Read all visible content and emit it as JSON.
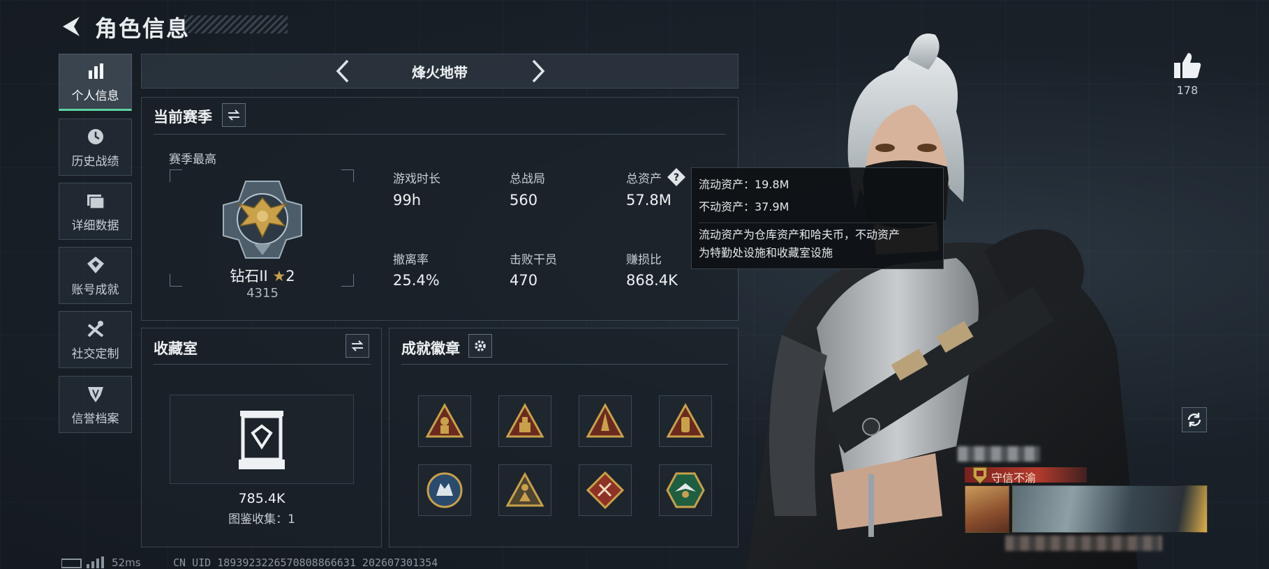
{
  "header": {
    "title": "角色信息"
  },
  "sidebar": {
    "items": [
      {
        "label": "个人信息",
        "icon": "bar-chart-icon",
        "active": true
      },
      {
        "label": "历史战绩",
        "icon": "clock-icon",
        "active": false
      },
      {
        "label": "详细数据",
        "icon": "folder-icon",
        "active": false
      },
      {
        "label": "账号成就",
        "icon": "achievement-icon",
        "active": false
      },
      {
        "label": "社交定制",
        "icon": "tools-icon",
        "active": false
      },
      {
        "label": "信誉档案",
        "icon": "shield-icon",
        "active": false
      }
    ]
  },
  "mode": {
    "name": "烽火地带"
  },
  "season": {
    "title": "当前赛季",
    "best_label": "赛季最高",
    "rank_name": "钻石II",
    "rank_stars": "2",
    "rank_points": "4315",
    "stats": [
      {
        "label": "游戏时长",
        "value": "99h"
      },
      {
        "label": "总战局",
        "value": "560"
      },
      {
        "label": "总资产",
        "value": "57.8M"
      },
      {
        "label": "撤离率",
        "value": "25.4%"
      },
      {
        "label": "击败干员",
        "value": "470"
      },
      {
        "label": "赚损比",
        "value": "868.4K"
      }
    ]
  },
  "tooltip": {
    "liquid": "流动资产：19.8M",
    "fixed": "不动资产：37.9M",
    "desc_line1": "流动资产为仓库资产和哈夫币，不动资产",
    "desc_line2": "为特勤处设施和收藏室设施"
  },
  "collection": {
    "title": "收藏室",
    "value": "785.4K",
    "count": "图鉴收集：1"
  },
  "badges": {
    "title": "成就徽章",
    "items": [
      {
        "icon": "soldier-triangle-badge-icon",
        "color": "#c9a14a"
      },
      {
        "icon": "crate-triangle-badge-icon",
        "color": "#c9a14a"
      },
      {
        "icon": "rocket-triangle-badge-icon",
        "color": "#c9a14a"
      },
      {
        "icon": "canister-triangle-badge-icon",
        "color": "#c9a14a"
      },
      {
        "icon": "wolf-circle-badge-icon",
        "color": "#3a6b9a"
      },
      {
        "icon": "figure-triangle-badge-icon",
        "color": "#c9a14a"
      },
      {
        "icon": "tools-diamond-badge-icon",
        "color": "#b5402f"
      },
      {
        "icon": "eagle-hexagon-badge-icon",
        "color": "#2f8a5a"
      }
    ]
  },
  "profile": {
    "likes": "178",
    "card_title": "守信不渝"
  },
  "footer": {
    "ping": "52ms",
    "uid": "CN UID 1893923226570808866631 202607301354"
  },
  "colors": {
    "accent": "#5fd3a4",
    "gold": "#c9a14a",
    "background": "#1a2129"
  }
}
